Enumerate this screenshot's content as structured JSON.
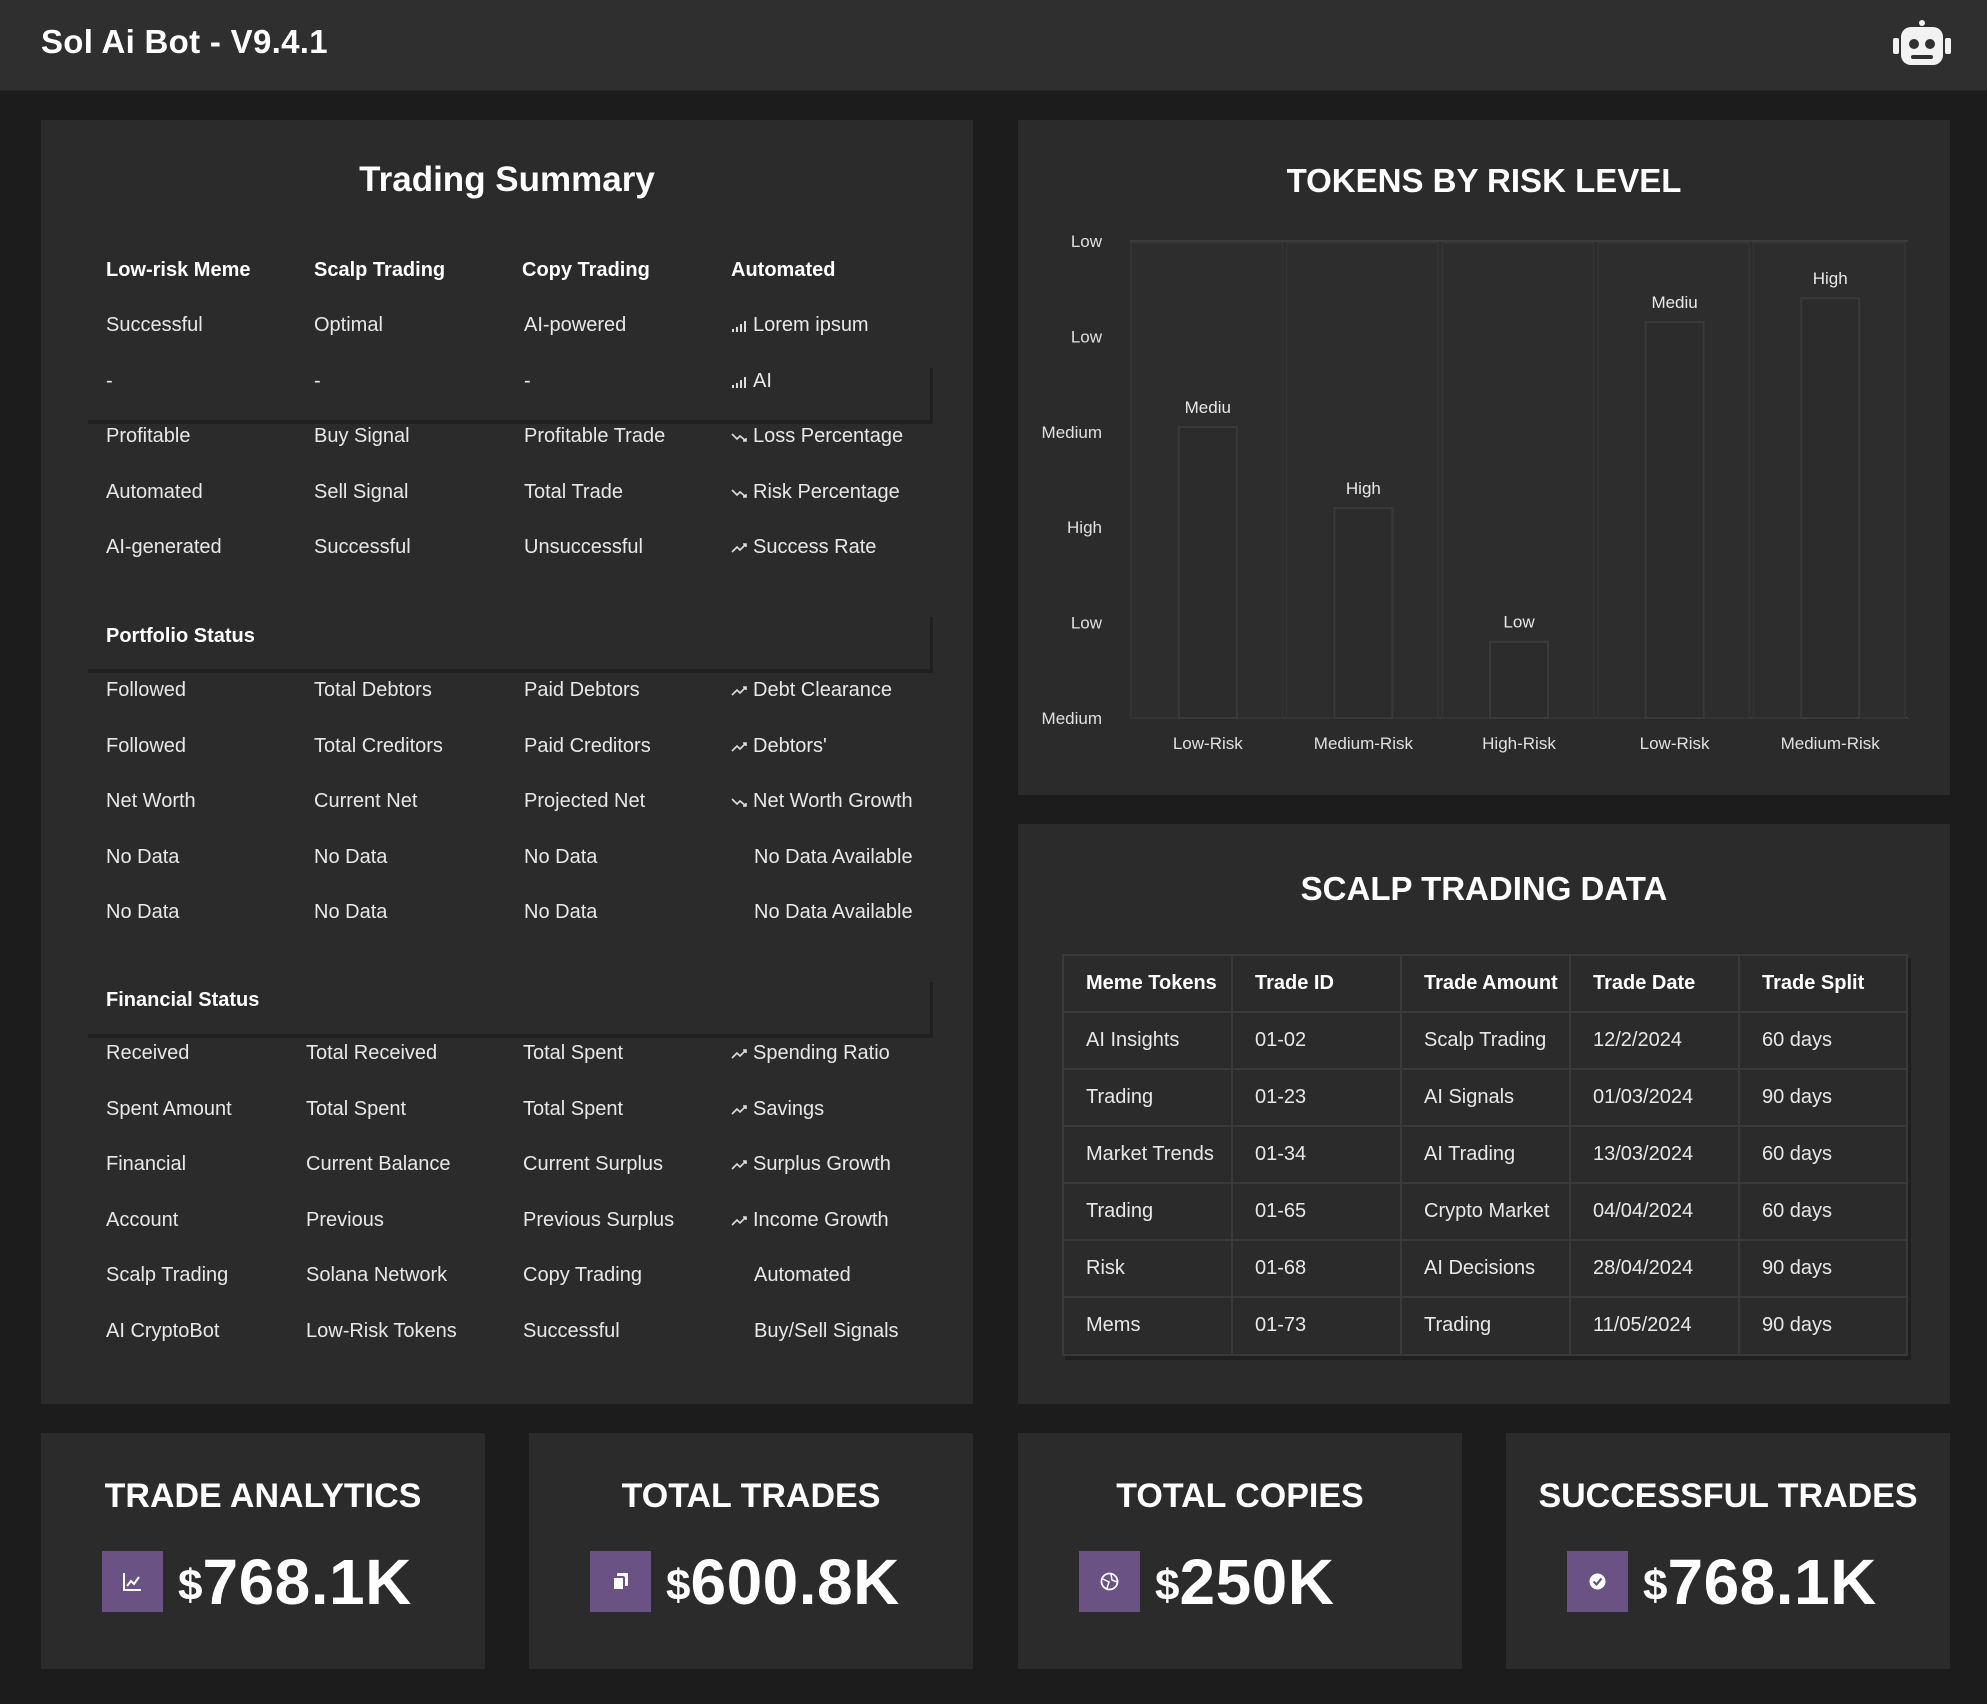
{
  "app": {
    "title": "Sol Ai Bot - V9.4.1",
    "icon": "robot-icon"
  },
  "summary": {
    "title": "Trading Summary",
    "headers": [
      "Low-risk Meme",
      "Scalp Trading",
      "Copy Trading",
      "Automated"
    ],
    "rows": [
      [
        "Successful",
        "Optimal",
        "AI-powered",
        "Lorem ipsum"
      ],
      [
        "-",
        "-",
        "-",
        "AI"
      ],
      [
        "Profitable",
        "Buy Signal",
        "Profitable Trade",
        "Loss Percentage"
      ],
      [
        "Automated",
        "Sell Signal",
        "Total Trade",
        "Risk Percentage"
      ],
      [
        "AI-generated",
        "Successful",
        "Unsuccessful",
        "Success Rate"
      ]
    ],
    "row_icons": [
      "signal-icon",
      "signal-icon",
      "trend-down-icon",
      "trend-down-icon",
      "trend-up-icon"
    ],
    "portfolio_title": "Portfolio Status",
    "portfolio_rows": [
      [
        "Followed",
        "Total Debtors",
        "Paid Debtors",
        "Debt Clearance"
      ],
      [
        "Followed",
        "Total Creditors",
        "Paid Creditors",
        "Debtors'"
      ],
      [
        "Net Worth",
        "Current Net",
        "Projected Net",
        "Net Worth Growth"
      ],
      [
        "No Data",
        "No Data",
        "No Data",
        "No Data Available"
      ],
      [
        "No Data",
        "No Data",
        "No Data",
        "No Data Available"
      ]
    ],
    "portfolio_icons": [
      "trend-up-icon",
      "trend-up-icon",
      "trend-down-icon",
      "",
      ""
    ],
    "financial_title": "Financial Status",
    "financial_rows": [
      [
        "Received",
        "Total Received",
        "Total Spent",
        "Spending Ratio"
      ],
      [
        "Spent Amount",
        "Total Spent",
        "Total Spent",
        "Savings"
      ],
      [
        "Financial",
        "Current Balance",
        "Current Surplus",
        "Surplus Growth"
      ],
      [
        "Account",
        "Previous",
        "Previous Surplus",
        "Income Growth"
      ],
      [
        "Scalp Trading",
        "Solana Network",
        "Copy Trading",
        "Automated"
      ],
      [
        "AI CryptoBot",
        "Low-Risk Tokens",
        "Successful",
        "Buy/Sell Signals"
      ]
    ],
    "financial_icons": [
      "trend-up-icon",
      "trend-up-icon",
      "trend-up-icon",
      "trend-up-icon",
      "",
      ""
    ]
  },
  "chart_data": {
    "type": "bar",
    "title": "TOKENS BY RISK LEVEL",
    "categories": [
      "Low-Risk",
      "Medium-Risk",
      "High-Risk",
      "Low-Risk",
      "Medium-Risk"
    ],
    "y_tick_labels": [
      "Low",
      "Low",
      "Medium",
      "High",
      "Low",
      "Medium"
    ],
    "values": [
      0.61,
      0.44,
      0.16,
      0.83,
      0.88
    ],
    "data_labels": [
      "Mediu",
      "High",
      "Low",
      "Mediu",
      "High"
    ],
    "ylim": [
      0,
      1
    ],
    "grid": false,
    "xlabel": "",
    "ylabel": ""
  },
  "scalp": {
    "title": "SCALP TRADING DATA",
    "headers": [
      "Meme Tokens",
      "Trade ID",
      "Trade Amount",
      "Trade Date",
      "Trade Split"
    ],
    "rows": [
      [
        "AI Insights",
        "01-02",
        "Scalp Trading",
        "12/2/2024",
        "60 days"
      ],
      [
        "Trading",
        "01-23",
        "AI Signals",
        "01/03/2024",
        "90 days"
      ],
      [
        "Market Trends",
        "01-34",
        "AI Trading",
        "13/03/2024",
        "60 days"
      ],
      [
        "Trading",
        "01-65",
        "Crypto Market",
        "04/04/2024",
        "60 days"
      ],
      [
        "Risk",
        "01-68",
        "AI Decisions",
        "28/04/2024",
        "90 days"
      ],
      [
        "Mems",
        "01-73",
        "Trading",
        "11/05/2024",
        "90 days"
      ]
    ]
  },
  "kpis": [
    {
      "title": "TRADE ANALYTICS",
      "currency": "$",
      "value": "768.1K",
      "icon": "chart-icon"
    },
    {
      "title": "TOTAL TRADES",
      "currency": "$",
      "value": "600.8K",
      "icon": "copy-icon"
    },
    {
      "title": "TOTAL COPIES",
      "currency": "$",
      "value": "250K",
      "icon": "globe-icon"
    },
    {
      "title": "SUCCESSFUL TRADES",
      "currency": "$",
      "value": "768.1K",
      "icon": "check-circle-icon"
    }
  ],
  "colors": {
    "background": "#1c1c1c",
    "panel": "#2b2b2b",
    "accent": "#6a5285",
    "text": "#ececec"
  }
}
